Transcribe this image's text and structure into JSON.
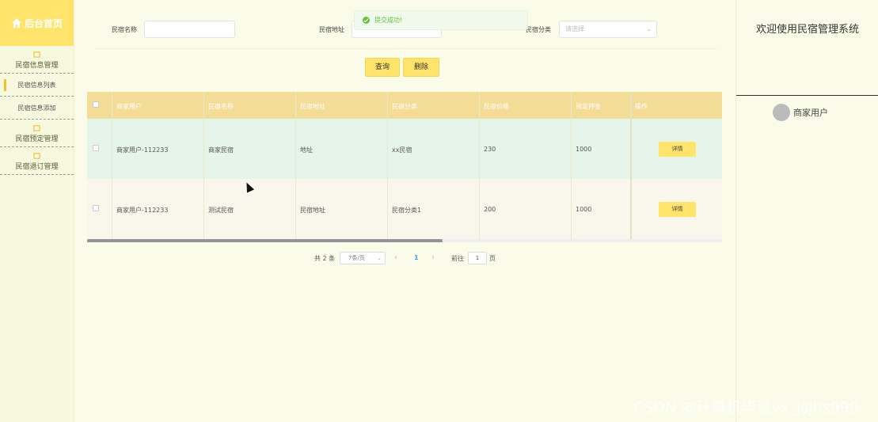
{
  "sidebar": {
    "home_label": "后台首页",
    "groups": [
      {
        "label": "民宿信息管理",
        "items": [
          "民宿信息列表",
          "民宿信息添加"
        ]
      },
      {
        "label": "民宿预定管理",
        "items": []
      },
      {
        "label": "民宿退订管理",
        "items": []
      }
    ]
  },
  "right_panel": {
    "title": "欢迎使用民宿管理系统",
    "user_role": "商家用户"
  },
  "toast": "提交成功!",
  "filters": {
    "name_label": "民宿名称",
    "address_label": "民宿地址",
    "category_label": "民宿分类",
    "category_placeholder": "请选择",
    "name_value": "",
    "address_value": ""
  },
  "actions": {
    "query": "查询",
    "delete": "删除"
  },
  "table": {
    "headers": [
      "商家用户",
      "民宿名称",
      "民宿地址",
      "民宿分类",
      "民宿价格",
      "预定押金",
      "操作"
    ],
    "rows": [
      [
        "商家用户-112233",
        "商家民宿",
        "地址",
        "xx民宿",
        "230",
        "1000"
      ],
      [
        "商家用户-112233",
        "测试民宿",
        "民宿地址",
        "民宿分类1",
        "200",
        "1000"
      ]
    ],
    "detail_label": "详情",
    "scroll_fraction": 0.56
  },
  "pagination": {
    "total_text": "共 2 条",
    "page_size": "7条/页",
    "current_page": "1",
    "goto_label": "前往",
    "goto_value": "1",
    "page_suffix": "页"
  },
  "watermark": "CSDN @计算机毕设vx_jsjbs999",
  "colors": {
    "accent": "#ffe36a",
    "header": "#f2dc96",
    "success": "#67c23a"
  }
}
